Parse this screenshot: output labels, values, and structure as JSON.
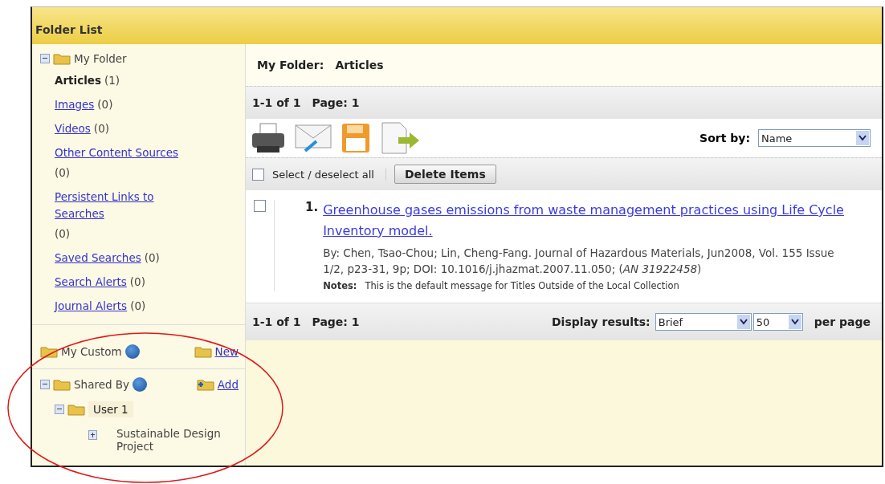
{
  "header": {
    "title": "Folder List"
  },
  "sidebar": {
    "my_folder": {
      "label": "My Folder",
      "expanded": true,
      "items": [
        {
          "label": "Articles",
          "count": "(1)",
          "selected": true
        },
        {
          "label": "Images",
          "count": "(0)",
          "selected": false
        },
        {
          "label": "Videos",
          "count": "(0)",
          "selected": false
        },
        {
          "label": "Other Content Sources",
          "count": "(0)",
          "selected": false
        },
        {
          "label": "Persistent Links to Searches",
          "count": "(0)",
          "selected": false
        },
        {
          "label": "Saved Searches",
          "count": "(0)",
          "selected": false
        },
        {
          "label": "Search Alerts",
          "count": "(0)",
          "selected": false
        },
        {
          "label": "Journal Alerts",
          "count": "(0)",
          "selected": false
        }
      ]
    },
    "my_custom": {
      "label": "My Custom",
      "action": "New"
    },
    "shared_by": {
      "label": "Shared By",
      "action": "Add",
      "expanded": true,
      "children": [
        {
          "label": "User 1",
          "expanded": true,
          "children": [
            {
              "label": "Sustainable Design Project",
              "expanded": false
            }
          ]
        }
      ]
    }
  },
  "main": {
    "breadcrumb": {
      "label": "My Folder:",
      "value": "Articles"
    },
    "pager_top": {
      "range": "1-1 of 1",
      "page": "Page: 1"
    },
    "sort": {
      "label": "Sort by:",
      "value": "Name"
    },
    "select_all": {
      "label": "Select / deselect all",
      "checked": false
    },
    "delete_button": "Delete Items",
    "results": [
      {
        "number": "1.",
        "title": "Greenhouse gases emissions from waste management practices using Life Cycle Inventory model.",
        "citation": "By: Chen, Tsao-Chou; Lin, Cheng-Fang. Journal of Hazardous Materials, Jun2008, Vol. 155 Issue 1/2, p23-31, 9p; DOI: 10.1016/j.jhazmat.2007.11.050; (*AN 31922458*)",
        "notes_label": "Notes:",
        "notes": "This is the default message for Titles Outside of the Local Collection",
        "checked": false
      }
    ],
    "pager_bottom": {
      "range": "1-1 of 1",
      "page": "Page: 1",
      "display_label": "Display results:",
      "display_value": "Brief",
      "per_page_value": "50",
      "per_page_label": "per page"
    }
  }
}
